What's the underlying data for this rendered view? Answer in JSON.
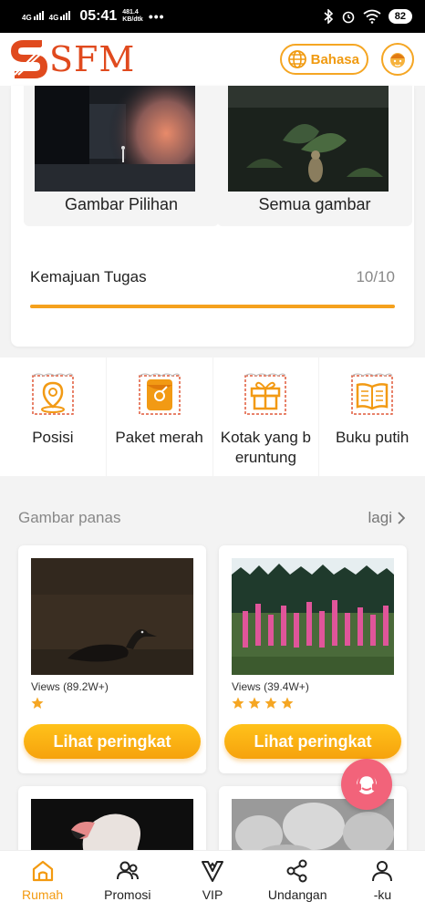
{
  "status_bar": {
    "network1": "4G",
    "network2": "4G",
    "time": "05:41",
    "speed_value": "481.4",
    "speed_unit": "KB/dtk",
    "dots": "•••",
    "battery": "82"
  },
  "header": {
    "brand": "SFM",
    "language_button": "Bahasa"
  },
  "gallery": {
    "tiles": [
      {
        "label": "Gambar Pilihan"
      },
      {
        "label": "Semua gambar"
      }
    ]
  },
  "task_progress": {
    "title": "Kemajuan Tugas",
    "count_text": "10/10",
    "progress": 1.0
  },
  "quick_menu": {
    "items": [
      {
        "label": "Posisi",
        "icon": "location-icon"
      },
      {
        "label": "Paket merah",
        "icon": "red-packet-icon"
      },
      {
        "label": "Kotak yang b eruntung",
        "icon": "gift-box-icon"
      },
      {
        "label": "Buku putih",
        "icon": "book-icon"
      }
    ]
  },
  "hot_pictures": {
    "title": "Gambar panas",
    "more_label": "lagi",
    "cards": [
      {
        "views": "Views (89.2W+)",
        "stars": 1,
        "button": "Lihat peringkat"
      },
      {
        "views": "Views (39.4W+)",
        "stars": 4,
        "button": "Lihat peringkat"
      }
    ]
  },
  "bottom_nav": {
    "items": [
      {
        "label": "Rumah",
        "icon": "home-icon",
        "active": true
      },
      {
        "label": "Promosi",
        "icon": "users-icon",
        "active": false
      },
      {
        "label": "VIP",
        "icon": "vip-icon",
        "active": false
      },
      {
        "label": "Undangan",
        "icon": "share-icon",
        "active": false
      },
      {
        "label": "-ku",
        "icon": "profile-icon",
        "active": false
      }
    ]
  },
  "colors": {
    "accent": "#f5a11d",
    "brand": "#e04a1e",
    "support": "#f2637a"
  }
}
